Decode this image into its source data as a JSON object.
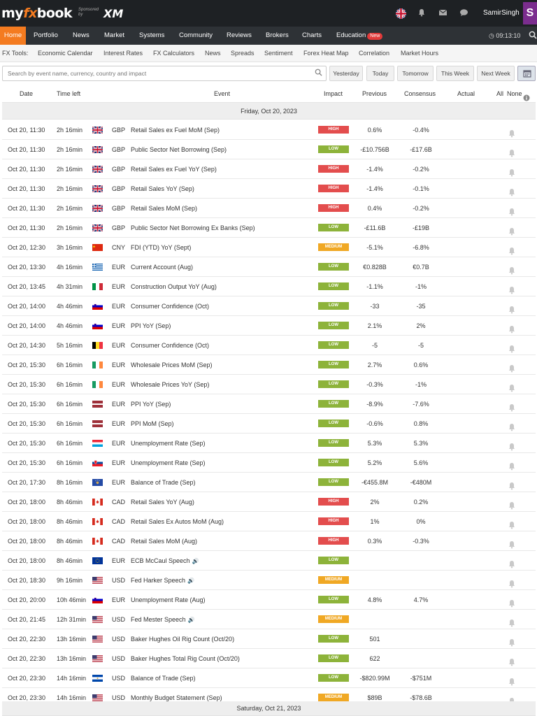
{
  "header": {
    "logo_my": "my",
    "logo_fx": "fx",
    "logo_book": "book",
    "sponsor_text": "Sponsored by",
    "sponsor_brand": "XM",
    "username": "SamirSingh",
    "avatar_letter": "S"
  },
  "nav": {
    "items": [
      "Home",
      "Portfolio",
      "News",
      "Market",
      "Systems",
      "Community",
      "Reviews",
      "Brokers",
      "Charts",
      "Education"
    ],
    "badge_new": "New",
    "clock": "09:13:10"
  },
  "tools": {
    "label": "FX Tools:",
    "items": [
      "Economic Calendar",
      "Interest Rates",
      "FX Calculators",
      "News",
      "Spreads",
      "Sentiment",
      "Forex Heat Map",
      "Correlation",
      "Market Hours"
    ]
  },
  "search": {
    "placeholder": "Search by event name, currency, country and impact"
  },
  "date_buttons": [
    "Yesterday",
    "Today",
    "Tomorrow",
    "This Week",
    "Next Week"
  ],
  "columns": {
    "date": "Date",
    "time_left": "Time left",
    "event": "Event",
    "impact": "Impact",
    "previous": "Previous",
    "consensus": "Consensus",
    "actual": "Actual",
    "all": "All",
    "none": "None"
  },
  "day_header": "Friday, Oct 20, 2023",
  "next_day_header": "Saturday, Oct 21, 2023",
  "colors": {
    "nav_active": "#f47b20",
    "impact_high": "#e34d4d",
    "impact_low": "#8db33a",
    "impact_medium": "#f0a824",
    "topbar": "#1e2124",
    "avatar": "#7b2d8e"
  },
  "events": [
    {
      "date": "Oct 20, 11:30",
      "time_left": "2h 16min",
      "flag": "gb",
      "currency": "GBP",
      "event": "Retail Sales ex Fuel MoM (Sep)",
      "impact": "HIGH",
      "impact_class": "high",
      "previous": "0.6%",
      "consensus": "-0.4%",
      "actual": ""
    },
    {
      "date": "Oct 20, 11:30",
      "time_left": "2h 16min",
      "flag": "gb",
      "currency": "GBP",
      "event": "Public Sector Net Borrowing (Sep)",
      "impact": "LOW",
      "impact_class": "low",
      "previous": "-£10.756B",
      "consensus": "-£17.6B",
      "actual": ""
    },
    {
      "date": "Oct 20, 11:30",
      "time_left": "2h 16min",
      "flag": "gb",
      "currency": "GBP",
      "event": "Retail Sales ex Fuel YoY (Sep)",
      "impact": "HIGH",
      "impact_class": "high",
      "previous": "-1.4%",
      "consensus": "-0.2%",
      "actual": ""
    },
    {
      "date": "Oct 20, 11:30",
      "time_left": "2h 16min",
      "flag": "gb",
      "currency": "GBP",
      "event": "Retail Sales YoY (Sep)",
      "impact": "HIGH",
      "impact_class": "high",
      "previous": "-1.4%",
      "consensus": "-0.1%",
      "actual": ""
    },
    {
      "date": "Oct 20, 11:30",
      "time_left": "2h 16min",
      "flag": "gb",
      "currency": "GBP",
      "event": "Retail Sales MoM (Sep)",
      "impact": "HIGH",
      "impact_class": "high",
      "previous": "0.4%",
      "consensus": "-0.2%",
      "actual": ""
    },
    {
      "date": "Oct 20, 11:30",
      "time_left": "2h 16min",
      "flag": "gb",
      "currency": "GBP",
      "event": "Public Sector Net Borrowing Ex Banks (Sep)",
      "impact": "LOW",
      "impact_class": "low",
      "previous": "-£11.6B",
      "consensus": "-£19B",
      "actual": ""
    },
    {
      "date": "Oct 20, 12:30",
      "time_left": "3h 16min",
      "flag": "cn",
      "currency": "CNY",
      "event": "FDI (YTD) YoY (Sept)",
      "impact": "MEDIUM",
      "impact_class": "medium",
      "previous": "-5.1%",
      "consensus": "-6.8%",
      "actual": ""
    },
    {
      "date": "Oct 20, 13:30",
      "time_left": "4h 16min",
      "flag": "gr",
      "currency": "EUR",
      "event": "Current Account (Aug)",
      "impact": "LOW",
      "impact_class": "low",
      "previous": "€0.828B",
      "consensus": "€0.7B",
      "actual": ""
    },
    {
      "date": "Oct 20, 13:45",
      "time_left": "4h 31min",
      "flag": "it",
      "currency": "EUR",
      "event": "Construction Output YoY (Aug)",
      "impact": "LOW",
      "impact_class": "low",
      "previous": "-1.1%",
      "consensus": "-1%",
      "actual": ""
    },
    {
      "date": "Oct 20, 14:00",
      "time_left": "4h 46min",
      "flag": "si",
      "currency": "EUR",
      "event": "Consumer Confidence (Oct)",
      "impact": "LOW",
      "impact_class": "low",
      "previous": "-33",
      "consensus": "-35",
      "actual": ""
    },
    {
      "date": "Oct 20, 14:00",
      "time_left": "4h 46min",
      "flag": "si",
      "currency": "EUR",
      "event": "PPI YoY (Sep)",
      "impact": "LOW",
      "impact_class": "low",
      "previous": "2.1%",
      "consensus": "2%",
      "actual": ""
    },
    {
      "date": "Oct 20, 14:30",
      "time_left": "5h 16min",
      "flag": "be",
      "currency": "EUR",
      "event": "Consumer Confidence (Oct)",
      "impact": "LOW",
      "impact_class": "low",
      "previous": "-5",
      "consensus": "-5",
      "actual": ""
    },
    {
      "date": "Oct 20, 15:30",
      "time_left": "6h 16min",
      "flag": "ie",
      "currency": "EUR",
      "event": "Wholesale Prices MoM (Sep)",
      "impact": "LOW",
      "impact_class": "low",
      "previous": "2.7%",
      "consensus": "0.6%",
      "actual": ""
    },
    {
      "date": "Oct 20, 15:30",
      "time_left": "6h 16min",
      "flag": "ie",
      "currency": "EUR",
      "event": "Wholesale Prices YoY (Sep)",
      "impact": "LOW",
      "impact_class": "low",
      "previous": "-0.3%",
      "consensus": "-1%",
      "actual": ""
    },
    {
      "date": "Oct 20, 15:30",
      "time_left": "6h 16min",
      "flag": "lv",
      "currency": "EUR",
      "event": "PPI YoY (Sep)",
      "impact": "LOW",
      "impact_class": "low",
      "previous": "-8.9%",
      "consensus": "-7.6%",
      "actual": ""
    },
    {
      "date": "Oct 20, 15:30",
      "time_left": "6h 16min",
      "flag": "lv",
      "currency": "EUR",
      "event": "PPI MoM (Sep)",
      "impact": "LOW",
      "impact_class": "low",
      "previous": "-0.6%",
      "consensus": "0.8%",
      "actual": ""
    },
    {
      "date": "Oct 20, 15:30",
      "time_left": "6h 16min",
      "flag": "lu",
      "currency": "EUR",
      "event": "Unemployment Rate (Sep)",
      "impact": "LOW",
      "impact_class": "low",
      "previous": "5.3%",
      "consensus": "5.3%",
      "actual": ""
    },
    {
      "date": "Oct 20, 15:30",
      "time_left": "6h 16min",
      "flag": "sk",
      "currency": "EUR",
      "event": "Unemployment Rate (Sep)",
      "impact": "LOW",
      "impact_class": "low",
      "previous": "5.2%",
      "consensus": "5.6%",
      "actual": ""
    },
    {
      "date": "Oct 20, 17:30",
      "time_left": "8h 16min",
      "flag": "xk",
      "currency": "EUR",
      "event": "Balance of Trade (Sep)",
      "impact": "LOW",
      "impact_class": "low",
      "previous": "-€455.8M",
      "consensus": "-€480M",
      "actual": ""
    },
    {
      "date": "Oct 20, 18:00",
      "time_left": "8h 46min",
      "flag": "ca",
      "currency": "CAD",
      "event": "Retail Sales YoY (Aug)",
      "impact": "HIGH",
      "impact_class": "high",
      "previous": "2%",
      "consensus": "0.2%",
      "actual": ""
    },
    {
      "date": "Oct 20, 18:00",
      "time_left": "8h 46min",
      "flag": "ca",
      "currency": "CAD",
      "event": "Retail Sales Ex Autos MoM (Aug)",
      "impact": "HIGH",
      "impact_class": "high",
      "previous": "1%",
      "consensus": "0%",
      "actual": ""
    },
    {
      "date": "Oct 20, 18:00",
      "time_left": "8h 46min",
      "flag": "ca",
      "currency": "CAD",
      "event": "Retail Sales MoM (Aug)",
      "impact": "HIGH",
      "impact_class": "high",
      "previous": "0.3%",
      "consensus": "-0.3%",
      "actual": ""
    },
    {
      "date": "Oct 20, 18:00",
      "time_left": "8h 46min",
      "flag": "eu",
      "currency": "EUR",
      "event": "ECB McCaul Speech",
      "speech": true,
      "impact": "LOW",
      "impact_class": "low",
      "previous": "",
      "consensus": "",
      "actual": ""
    },
    {
      "date": "Oct 20, 18:30",
      "time_left": "9h 16min",
      "flag": "us",
      "currency": "USD",
      "event": "Fed Harker Speech",
      "speech": true,
      "impact": "MEDIUM",
      "impact_class": "medium",
      "previous": "",
      "consensus": "",
      "actual": ""
    },
    {
      "date": "Oct 20, 20:00",
      "time_left": "10h 46min",
      "flag": "si",
      "currency": "EUR",
      "event": "Unemployment Rate (Aug)",
      "impact": "LOW",
      "impact_class": "low",
      "previous": "4.8%",
      "consensus": "4.7%",
      "actual": ""
    },
    {
      "date": "Oct 20, 21:45",
      "time_left": "12h 31min",
      "flag": "us",
      "currency": "USD",
      "event": "Fed Mester Speech",
      "speech": true,
      "impact": "MEDIUM",
      "impact_class": "medium",
      "previous": "",
      "consensus": "",
      "actual": ""
    },
    {
      "date": "Oct 20, 22:30",
      "time_left": "13h 16min",
      "flag": "us",
      "currency": "USD",
      "event": "Baker Hughes Oil Rig Count (Oct/20)",
      "impact": "LOW",
      "impact_class": "low",
      "previous": "501",
      "consensus": "",
      "actual": ""
    },
    {
      "date": "Oct 20, 22:30",
      "time_left": "13h 16min",
      "flag": "us",
      "currency": "USD",
      "event": "Baker Hughes Total Rig Count (Oct/20)",
      "impact": "LOW",
      "impact_class": "low",
      "previous": "622",
      "consensus": "",
      "actual": ""
    },
    {
      "date": "Oct 20, 23:30",
      "time_left": "14h 16min",
      "flag": "sv",
      "currency": "USD",
      "event": "Balance of Trade (Sep)",
      "impact": "LOW",
      "impact_class": "low",
      "previous": "-$820.99M",
      "consensus": "-$751M",
      "actual": ""
    },
    {
      "date": "Oct 20, 23:30",
      "time_left": "14h 16min",
      "flag": "us",
      "currency": "USD",
      "event": "Monthly Budget Statement (Sep)",
      "impact": "MEDIUM",
      "impact_class": "medium",
      "previous": "$89B",
      "consensus": "-$78.6B",
      "actual": ""
    }
  ]
}
